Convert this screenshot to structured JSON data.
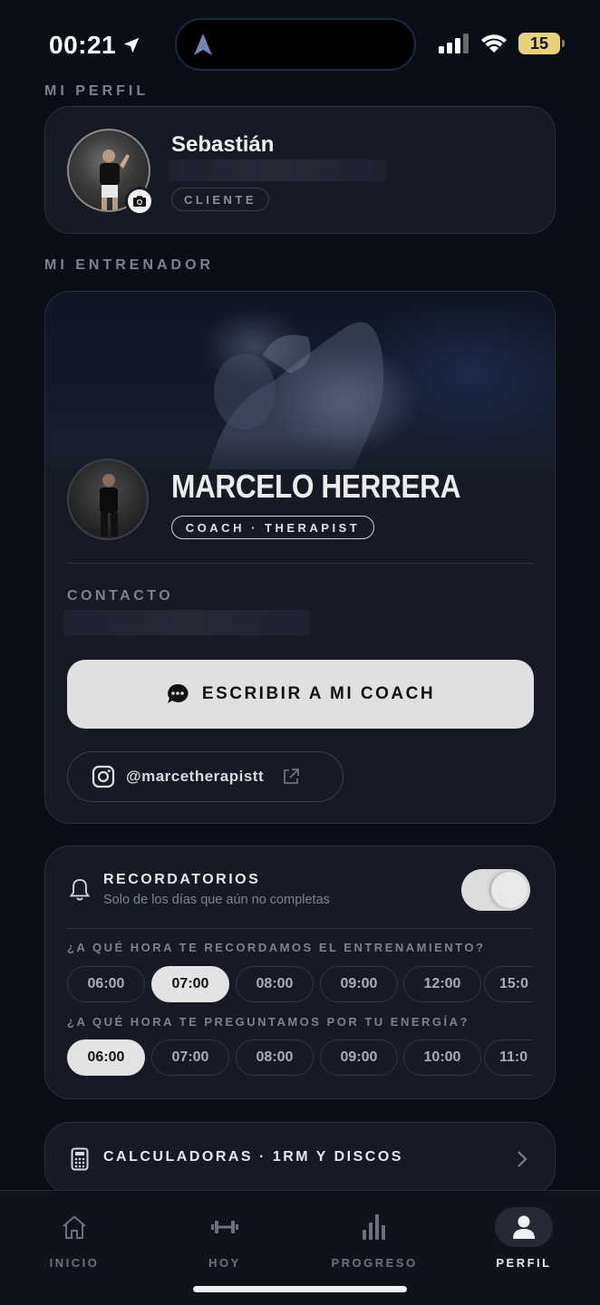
{
  "status_bar": {
    "time": "00:21",
    "battery": "15"
  },
  "profile": {
    "section_label": "MI PERFIL",
    "name": "Sebastián",
    "role_badge": "CLIENTE"
  },
  "trainer": {
    "section_label": "MI ENTRENADOR",
    "name": "MARCELO HERRERA",
    "role_badge": "COACH · THERAPIST",
    "contact_label": "CONTACTO",
    "write_button": "ESCRIBIR A MI COACH",
    "instagram_handle": "@marcetherapistt"
  },
  "reminders": {
    "title": "RECORDATORIOS",
    "subtitle": "Solo de los días que aún no completas",
    "enabled": true,
    "training_question": "¿A QUÉ HORA TE RECORDAMOS EL ENTRENAMIENTO?",
    "training_times": [
      "06:00",
      "07:00",
      "08:00",
      "09:00",
      "12:00",
      "15:0"
    ],
    "training_selected": "07:00",
    "energy_question": "¿A QUÉ HORA TE PREGUNTAMOS POR TU ENERGÍA?",
    "energy_times": [
      "06:00",
      "07:00",
      "08:00",
      "09:00",
      "10:00",
      "11:0"
    ],
    "energy_selected": "06:00"
  },
  "calculators": {
    "label": "CALCULADORAS · 1RM Y DISCOS"
  },
  "bottom_nav": {
    "items": [
      {
        "label": "INICIO",
        "icon": "home-icon"
      },
      {
        "label": "HOY",
        "icon": "dumbbell-icon"
      },
      {
        "label": "PROGRESO",
        "icon": "bar-chart-icon"
      },
      {
        "label": "PERFIL",
        "icon": "person-icon"
      }
    ],
    "active": "PERFIL"
  }
}
